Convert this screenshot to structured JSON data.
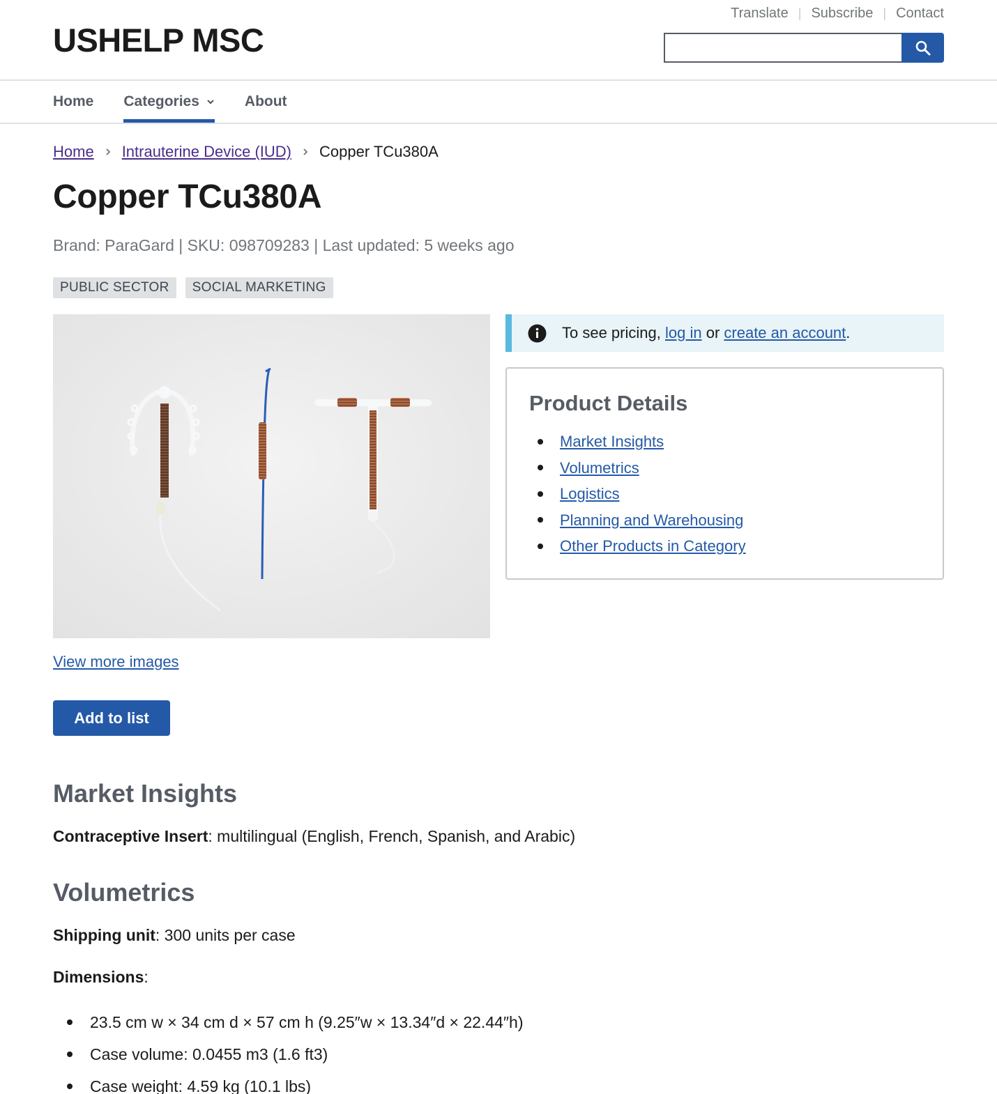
{
  "utility_nav": [
    "Translate",
    "Subscribe",
    "Contact"
  ],
  "site": {
    "title": "USHELP MSC"
  },
  "search": {
    "placeholder": "",
    "value": ""
  },
  "nav": {
    "items": [
      "Home",
      "Categories",
      "About"
    ],
    "active": "Categories"
  },
  "breadcrumb": [
    "Home",
    "Intrauterine Device (IUD)",
    "Copper TCu380A"
  ],
  "product": {
    "title": "Copper TCu380A",
    "meta": "Brand: ParaGard | SKU: 098709283 | Last updated: 5 weeks ago",
    "tags": [
      "PUBLIC SECTOR",
      "SOCIAL MARKETING"
    ],
    "view_more": "View more images",
    "add_button": "Add to list"
  },
  "alert": {
    "prefix": "To see pricing,",
    "login_link": "log in",
    "middle": "or",
    "create_link": "create an account",
    "suffix": "."
  },
  "details": {
    "heading": "Product Details",
    "links": [
      "Market Insights",
      "Volumetrics",
      "Logistics",
      "Planning and Warehousing",
      "Other Products in Category"
    ]
  },
  "market": {
    "heading": "Market Insights",
    "label": "Contraceptive Insert",
    "text": ": multilingual (English, French, Spanish, and Arabic)"
  },
  "volumetrics": {
    "heading": "Volumetrics",
    "shipping_label": "Shipping unit",
    "shipping_text": ": 300 units per case",
    "dimensions_label": "Dimensions",
    "dimensions_colon": ":",
    "items": [
      "23.5 cm w × 34 cm d × 57 cm h (9.25″w × 13.34″d × 22.44″h)",
      "Case volume: 0.0455 m3 (1.6 ft3)",
      "Case weight: 4.59 kg (10.1 lbs)"
    ]
  },
  "colors": {
    "primary": "#2459a7",
    "alert_border": "#59b9de",
    "alert_bg": "#e8f4f7",
    "link_visited": "#4a2e8c"
  },
  "icons": [
    "search-icon",
    "chevron-down-icon",
    "chevron-right-icon",
    "info-icon"
  ]
}
